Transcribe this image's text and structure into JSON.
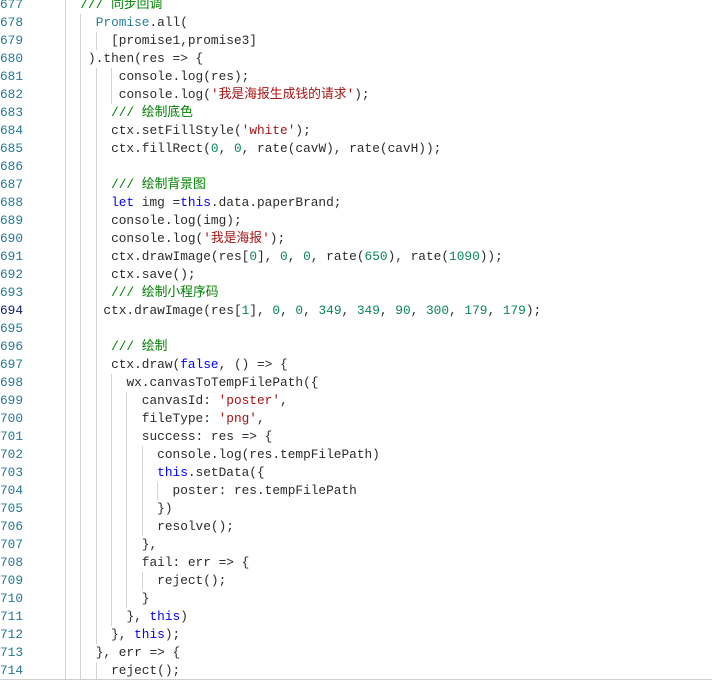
{
  "colors": {
    "background": "#ffffff",
    "line_number": "#237893",
    "active_line_number": "#0b216f",
    "indent_guide": "#d3d3d3",
    "bottom_border": "#cfcfcf",
    "syntax": {
      "indent": "#2b2b2b",
      "plain": "#2b2b2b",
      "comment": "#008000",
      "keyword": "#0000ff",
      "string": "#a31515",
      "number": "#098658",
      "type": "#267f99"
    }
  },
  "editor": {
    "lines": [
      {
        "number": "677",
        "tokens": [
          {
            "type": "indent",
            "text": "  "
          },
          {
            "type": "comment",
            "text": "/// 同步回调"
          }
        ]
      },
      {
        "number": "678",
        "tokens": [
          {
            "type": "indent",
            "text": "    "
          },
          {
            "type": "type",
            "text": "Promise"
          },
          {
            "type": "plain",
            "text": ".all("
          }
        ]
      },
      {
        "number": "679",
        "tokens": [
          {
            "type": "indent",
            "text": "      "
          },
          {
            "type": "plain",
            "text": "[promise1,promise3]"
          }
        ]
      },
      {
        "number": "680",
        "tokens": [
          {
            "type": "indent",
            "text": "   "
          },
          {
            "type": "plain",
            "text": ").then(res => {"
          }
        ]
      },
      {
        "number": "681",
        "tokens": [
          {
            "type": "indent",
            "text": "       "
          },
          {
            "type": "plain",
            "text": "console.log(res);"
          }
        ]
      },
      {
        "number": "682",
        "tokens": [
          {
            "type": "indent",
            "text": "       "
          },
          {
            "type": "plain",
            "text": "console.log("
          },
          {
            "type": "string",
            "text": "'我是海报生成钱的请求'"
          },
          {
            "type": "plain",
            "text": ");"
          }
        ]
      },
      {
        "number": "683",
        "tokens": [
          {
            "type": "indent",
            "text": "      "
          },
          {
            "type": "comment",
            "text": "/// 绘制底色"
          }
        ]
      },
      {
        "number": "684",
        "tokens": [
          {
            "type": "indent",
            "text": "      "
          },
          {
            "type": "plain",
            "text": "ctx.setFillStyle("
          },
          {
            "type": "string",
            "text": "'white'"
          },
          {
            "type": "plain",
            "text": ");"
          }
        ]
      },
      {
        "number": "685",
        "tokens": [
          {
            "type": "indent",
            "text": "      "
          },
          {
            "type": "plain",
            "text": "ctx.fillRect("
          },
          {
            "type": "number",
            "text": "0"
          },
          {
            "type": "plain",
            "text": ", "
          },
          {
            "type": "number",
            "text": "0"
          },
          {
            "type": "plain",
            "text": ", rate(cavW), rate(cavH));"
          }
        ]
      },
      {
        "number": "686",
        "tokens": []
      },
      {
        "number": "687",
        "tokens": [
          {
            "type": "indent",
            "text": "      "
          },
          {
            "type": "comment",
            "text": "/// 绘制背景图"
          }
        ]
      },
      {
        "number": "688",
        "tokens": [
          {
            "type": "indent",
            "text": "      "
          },
          {
            "type": "keyword",
            "text": "let"
          },
          {
            "type": "plain",
            "text": " img ="
          },
          {
            "type": "keyword",
            "text": "this"
          },
          {
            "type": "plain",
            "text": ".data.paperBrand;"
          }
        ]
      },
      {
        "number": "689",
        "tokens": [
          {
            "type": "indent",
            "text": "      "
          },
          {
            "type": "plain",
            "text": "console.log(img);"
          }
        ]
      },
      {
        "number": "690",
        "tokens": [
          {
            "type": "indent",
            "text": "      "
          },
          {
            "type": "plain",
            "text": "console.log("
          },
          {
            "type": "string",
            "text": "'我是海报'"
          },
          {
            "type": "plain",
            "text": ");"
          }
        ]
      },
      {
        "number": "691",
        "tokens": [
          {
            "type": "indent",
            "text": "      "
          },
          {
            "type": "plain",
            "text": "ctx.drawImage(res["
          },
          {
            "type": "number",
            "text": "0"
          },
          {
            "type": "plain",
            "text": "], "
          },
          {
            "type": "number",
            "text": "0"
          },
          {
            "type": "plain",
            "text": ", "
          },
          {
            "type": "number",
            "text": "0"
          },
          {
            "type": "plain",
            "text": ", rate("
          },
          {
            "type": "number",
            "text": "650"
          },
          {
            "type": "plain",
            "text": "), rate("
          },
          {
            "type": "number",
            "text": "1090"
          },
          {
            "type": "plain",
            "text": "));"
          }
        ]
      },
      {
        "number": "692",
        "tokens": [
          {
            "type": "indent",
            "text": "      "
          },
          {
            "type": "plain",
            "text": "ctx.save();"
          }
        ]
      },
      {
        "number": "693",
        "tokens": [
          {
            "type": "indent",
            "text": "      "
          },
          {
            "type": "comment",
            "text": "/// 绘制小程序码"
          }
        ]
      },
      {
        "number": "694",
        "active": true,
        "tokens": [
          {
            "type": "indent",
            "text": "     "
          },
          {
            "type": "plain",
            "text": "ctx.drawImage(res["
          },
          {
            "type": "number",
            "text": "1"
          },
          {
            "type": "plain",
            "text": "], "
          },
          {
            "type": "number",
            "text": "0"
          },
          {
            "type": "plain",
            "text": ", "
          },
          {
            "type": "number",
            "text": "0"
          },
          {
            "type": "plain",
            "text": ", "
          },
          {
            "type": "number",
            "text": "349"
          },
          {
            "type": "plain",
            "text": ", "
          },
          {
            "type": "number",
            "text": "349"
          },
          {
            "type": "plain",
            "text": ", "
          },
          {
            "type": "number",
            "text": "90"
          },
          {
            "type": "plain",
            "text": ", "
          },
          {
            "type": "number",
            "text": "300"
          },
          {
            "type": "plain",
            "text": ", "
          },
          {
            "type": "number",
            "text": "179"
          },
          {
            "type": "plain",
            "text": ", "
          },
          {
            "type": "number",
            "text": "179"
          },
          {
            "type": "plain",
            "text": ");"
          }
        ]
      },
      {
        "number": "695",
        "tokens": []
      },
      {
        "number": "696",
        "tokens": [
          {
            "type": "indent",
            "text": "      "
          },
          {
            "type": "comment",
            "text": "/// 绘制"
          }
        ]
      },
      {
        "number": "697",
        "tokens": [
          {
            "type": "indent",
            "text": "      "
          },
          {
            "type": "plain",
            "text": "ctx.draw("
          },
          {
            "type": "keyword",
            "text": "false"
          },
          {
            "type": "plain",
            "text": ", () => {"
          }
        ]
      },
      {
        "number": "698",
        "tokens": [
          {
            "type": "indent",
            "text": "        "
          },
          {
            "type": "plain",
            "text": "wx.canvasToTempFilePath({"
          }
        ]
      },
      {
        "number": "699",
        "tokens": [
          {
            "type": "indent",
            "text": "          "
          },
          {
            "type": "plain",
            "text": "canvasId: "
          },
          {
            "type": "string",
            "text": "'poster'"
          },
          {
            "type": "plain",
            "text": ","
          }
        ]
      },
      {
        "number": "700",
        "tokens": [
          {
            "type": "indent",
            "text": "          "
          },
          {
            "type": "plain",
            "text": "fileType: "
          },
          {
            "type": "string",
            "text": "'png'"
          },
          {
            "type": "plain",
            "text": ","
          }
        ]
      },
      {
        "number": "701",
        "tokens": [
          {
            "type": "indent",
            "text": "          "
          },
          {
            "type": "plain",
            "text": "success: res => {"
          }
        ]
      },
      {
        "number": "702",
        "tokens": [
          {
            "type": "indent",
            "text": "            "
          },
          {
            "type": "plain",
            "text": "console.log(res.tempFilePath)"
          }
        ]
      },
      {
        "number": "703",
        "tokens": [
          {
            "type": "indent",
            "text": "            "
          },
          {
            "type": "keyword",
            "text": "this"
          },
          {
            "type": "plain",
            "text": ".setData({"
          }
        ]
      },
      {
        "number": "704",
        "tokens": [
          {
            "type": "indent",
            "text": "              "
          },
          {
            "type": "plain",
            "text": "poster: res.tempFilePath"
          }
        ]
      },
      {
        "number": "705",
        "tokens": [
          {
            "type": "indent",
            "text": "            "
          },
          {
            "type": "plain",
            "text": "})"
          }
        ]
      },
      {
        "number": "706",
        "tokens": [
          {
            "type": "indent",
            "text": "            "
          },
          {
            "type": "plain",
            "text": "resolve();"
          }
        ]
      },
      {
        "number": "707",
        "tokens": [
          {
            "type": "indent",
            "text": "          "
          },
          {
            "type": "plain",
            "text": "},"
          }
        ]
      },
      {
        "number": "708",
        "tokens": [
          {
            "type": "indent",
            "text": "          "
          },
          {
            "type": "plain",
            "text": "fail: err => {"
          }
        ]
      },
      {
        "number": "709",
        "tokens": [
          {
            "type": "indent",
            "text": "            "
          },
          {
            "type": "plain",
            "text": "reject();"
          }
        ]
      },
      {
        "number": "710",
        "tokens": [
          {
            "type": "indent",
            "text": "          "
          },
          {
            "type": "plain",
            "text": "}"
          }
        ]
      },
      {
        "number": "711",
        "tokens": [
          {
            "type": "indent",
            "text": "        "
          },
          {
            "type": "plain",
            "text": "}, "
          },
          {
            "type": "keyword",
            "text": "this"
          },
          {
            "type": "plain",
            "text": ")"
          }
        ]
      },
      {
        "number": "712",
        "tokens": [
          {
            "type": "indent",
            "text": "      "
          },
          {
            "type": "plain",
            "text": "}, "
          },
          {
            "type": "keyword",
            "text": "this"
          },
          {
            "type": "plain",
            "text": ");"
          }
        ]
      },
      {
        "number": "713",
        "tokens": [
          {
            "type": "indent",
            "text": "    "
          },
          {
            "type": "plain",
            "text": "}, err => {"
          }
        ]
      },
      {
        "number": "714",
        "tokens": [
          {
            "type": "indent",
            "text": "      "
          },
          {
            "type": "plain",
            "text": "reject();"
          }
        ]
      }
    ]
  }
}
